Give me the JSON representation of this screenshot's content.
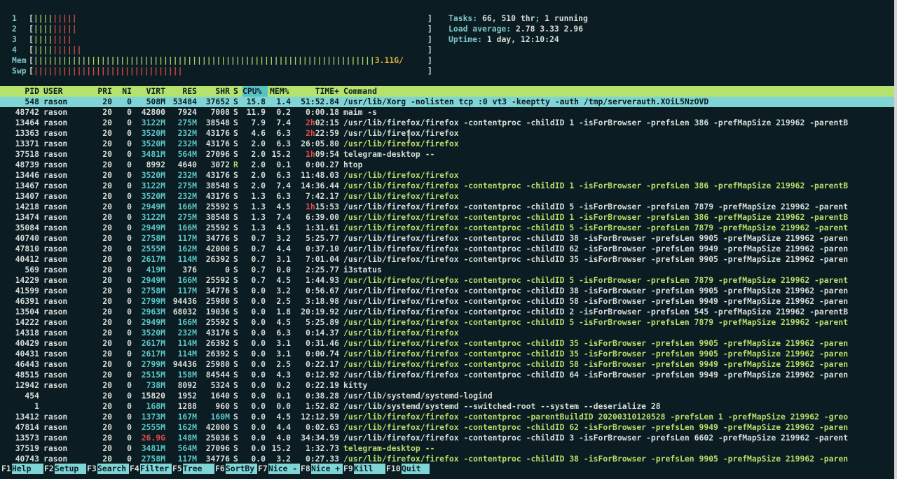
{
  "meters": {
    "cpus": [
      {
        "label": "1",
        "bar": "[",
        "g": "||||",
        "r": "|||||"
      },
      {
        "label": "2",
        "bar": "[",
        "g": "||||",
        "r": "|||||"
      },
      {
        "label": "3",
        "bar": "[",
        "g": "||||",
        "r": "||||"
      },
      {
        "label": "4",
        "bar": "[",
        "g": "||||",
        "r": "||||||"
      }
    ],
    "mem": {
      "label": "Mem",
      "bar": "[",
      "fill": "|||||||||||||||||||||||||||||||||||||||||||||||||||||||||||||||||||||||",
      "value": "3.11G/"
    },
    "swp": {
      "label": "Swp",
      "bar": "[",
      "fill": "|||||||||||||||||||||||||||||||"
    },
    "close": "]"
  },
  "info": {
    "tasks_label": "Tasks: ",
    "tasks_val": "66, 510 thr",
    "tasks_sep": "; ",
    "running_val": "1 running",
    "load_label": "Load average: ",
    "load_val": "2.78 3.33 2.96",
    "uptime_label": "Uptime: ",
    "uptime_val": "1 day, 12:10:24"
  },
  "header": {
    "pid": "PID",
    "user": "USER",
    "pri": "PRI",
    "ni": "NI",
    "virt": "VIRT",
    "res": "RES",
    "shr": "SHR",
    "s": "S",
    "cpu": "CPU%",
    "mem": "MEM%",
    "time": "TIME+",
    "cmd": "Command"
  },
  "processes": [
    {
      "pid": "548",
      "user": "rason",
      "pri": "20",
      "ni": "0",
      "virt": "508M",
      "res": "53484",
      "shr": "37652",
      "s": "S",
      "cpu": "15.8",
      "mem": "1.4",
      "time": "51:52.84",
      "cmd": "/usr/lib/Xorg -nolisten tcp :0 vt3 -keeptty -auth /tmp/serverauth.XOiL5NzOVD"
    },
    {
      "pid": "48742",
      "user": "rason",
      "pri": "20",
      "ni": "0",
      "virt": "42800",
      "res": "7924",
      "shr": "7008",
      "s": "S",
      "cpu": "11.9",
      "mem": "0.2",
      "time": "0:00.18",
      "cmd": "maim -s"
    },
    {
      "pid": "13464",
      "user": "rason",
      "pri": "20",
      "ni": "0",
      "virt": "3122M",
      "res": "275M",
      "shr": "38548",
      "s": "S",
      "cpu": "7.9",
      "mem": "7.4",
      "time": "2h02:15",
      "cmd": "/usr/lib/firefox/firefox -contentproc -childID 1 -isForBrowser -prefsLen 386 -prefMapSize 219962 -parentB"
    },
    {
      "pid": "13363",
      "user": "rason",
      "pri": "20",
      "ni": "0",
      "virt": "3520M",
      "res": "232M",
      "shr": "43176",
      "s": "S",
      "cpu": "4.6",
      "mem": "6.3",
      "time": "2h22:59",
      "cmd": "/usr/lib/firefox/firefox"
    },
    {
      "pid": "13371",
      "user": "rason",
      "pri": "20",
      "ni": "0",
      "virt": "3520M",
      "res": "232M",
      "shr": "43176",
      "s": "S",
      "cpu": "2.0",
      "mem": "6.3",
      "time": "26:05.80",
      "cmd": "/usr/lib/firefox/firefox"
    },
    {
      "pid": "37518",
      "user": "rason",
      "pri": "20",
      "ni": "0",
      "virt": "3481M",
      "res": "564M",
      "shr": "27096",
      "s": "S",
      "cpu": "2.0",
      "mem": "15.2",
      "time": "1h09:54",
      "cmd": "telegram-desktop --"
    },
    {
      "pid": "48739",
      "user": "rason",
      "pri": "20",
      "ni": "0",
      "virt": "8992",
      "res": "4640",
      "shr": "3072",
      "s": "R",
      "cpu": "2.0",
      "mem": "0.1",
      "time": "0:00.27",
      "cmd": "htop"
    },
    {
      "pid": "13446",
      "user": "rason",
      "pri": "20",
      "ni": "0",
      "virt": "3520M",
      "res": "232M",
      "shr": "43176",
      "s": "S",
      "cpu": "2.0",
      "mem": "6.3",
      "time": "11:48.03",
      "cmd": "/usr/lib/firefox/firefox"
    },
    {
      "pid": "13467",
      "user": "rason",
      "pri": "20",
      "ni": "0",
      "virt": "3122M",
      "res": "275M",
      "shr": "38548",
      "s": "S",
      "cpu": "2.0",
      "mem": "7.4",
      "time": "14:36.44",
      "cmd": "/usr/lib/firefox/firefox -contentproc -childID 1 -isForBrowser -prefsLen 386 -prefMapSize 219962 -parentB"
    },
    {
      "pid": "13407",
      "user": "rason",
      "pri": "20",
      "ni": "0",
      "virt": "3520M",
      "res": "232M",
      "shr": "43176",
      "s": "S",
      "cpu": "1.3",
      "mem": "6.3",
      "time": "7:42.17",
      "cmd": "/usr/lib/firefox/firefox"
    },
    {
      "pid": "14218",
      "user": "rason",
      "pri": "20",
      "ni": "0",
      "virt": "2949M",
      "res": "166M",
      "shr": "25592",
      "s": "S",
      "cpu": "1.3",
      "mem": "4.5",
      "time": "1h15:53",
      "cmd": "/usr/lib/firefox/firefox -contentproc -childID 5 -isForBrowser -prefsLen 7879 -prefMapSize 219962 -parent"
    },
    {
      "pid": "13474",
      "user": "rason",
      "pri": "20",
      "ni": "0",
      "virt": "3122M",
      "res": "275M",
      "shr": "38548",
      "s": "S",
      "cpu": "1.3",
      "mem": "7.4",
      "time": "6:39.00",
      "cmd": "/usr/lib/firefox/firefox -contentproc -childID 1 -isForBrowser -prefsLen 386 -prefMapSize 219962 -parentB"
    },
    {
      "pid": "35084",
      "user": "rason",
      "pri": "20",
      "ni": "0",
      "virt": "2949M",
      "res": "166M",
      "shr": "25592",
      "s": "S",
      "cpu": "1.3",
      "mem": "4.5",
      "time": "1:31.61",
      "cmd": "/usr/lib/firefox/firefox -contentproc -childID 5 -isForBrowser -prefsLen 7879 -prefMapSize 219962 -parent"
    },
    {
      "pid": "40740",
      "user": "rason",
      "pri": "20",
      "ni": "0",
      "virt": "2758M",
      "res": "117M",
      "shr": "34776",
      "s": "S",
      "cpu": "0.7",
      "mem": "3.2",
      "time": "5:25.77",
      "cmd": "/usr/lib/firefox/firefox -contentproc -childID 38 -isForBrowser -prefsLen 9905 -prefMapSize 219962 -paren"
    },
    {
      "pid": "47810",
      "user": "rason",
      "pri": "20",
      "ni": "0",
      "virt": "2555M",
      "res": "162M",
      "shr": "42000",
      "s": "S",
      "cpu": "0.7",
      "mem": "4.4",
      "time": "0:37.10",
      "cmd": "/usr/lib/firefox/firefox -contentproc -childID 62 -isForBrowser -prefsLen 9949 -prefMapSize 219962 -paren"
    },
    {
      "pid": "40412",
      "user": "rason",
      "pri": "20",
      "ni": "0",
      "virt": "2617M",
      "res": "114M",
      "shr": "26392",
      "s": "S",
      "cpu": "0.7",
      "mem": "3.1",
      "time": "7:01.04",
      "cmd": "/usr/lib/firefox/firefox -contentproc -childID 35 -isForBrowser -prefsLen 9905 -prefMapSize 219962 -paren"
    },
    {
      "pid": "569",
      "user": "rason",
      "pri": "20",
      "ni": "0",
      "virt": "419M",
      "res": "376",
      "shr": "0",
      "s": "S",
      "cpu": "0.7",
      "mem": "0.0",
      "time": "2:25.77",
      "cmd": "i3status"
    },
    {
      "pid": "14229",
      "user": "rason",
      "pri": "20",
      "ni": "0",
      "virt": "2949M",
      "res": "166M",
      "shr": "25592",
      "s": "S",
      "cpu": "0.7",
      "mem": "4.5",
      "time": "1:44.93",
      "cmd": "/usr/lib/firefox/firefox -contentproc -childID 5 -isForBrowser -prefsLen 7879 -prefMapSize 219962 -parent"
    },
    {
      "pid": "41599",
      "user": "rason",
      "pri": "20",
      "ni": "0",
      "virt": "2758M",
      "res": "117M",
      "shr": "34776",
      "s": "S",
      "cpu": "0.0",
      "mem": "3.2",
      "time": "0:56.67",
      "cmd": "/usr/lib/firefox/firefox -contentproc -childID 38 -isForBrowser -prefsLen 9905 -prefMapSize 219962 -paren"
    },
    {
      "pid": "46391",
      "user": "rason",
      "pri": "20",
      "ni": "0",
      "virt": "2799M",
      "res": "94436",
      "shr": "25980",
      "s": "S",
      "cpu": "0.0",
      "mem": "2.5",
      "time": "3:18.98",
      "cmd": "/usr/lib/firefox/firefox -contentproc -childID 58 -isForBrowser -prefsLen 9949 -prefMapSize 219962 -paren"
    },
    {
      "pid": "13504",
      "user": "rason",
      "pri": "20",
      "ni": "0",
      "virt": "2963M",
      "res": "68032",
      "shr": "19036",
      "s": "S",
      "cpu": "0.0",
      "mem": "1.8",
      "time": "20:19.92",
      "cmd": "/usr/lib/firefox/firefox -contentproc -childID 2 -isForBrowser -prefsLen 545 -prefMapSize 219962 -parentB"
    },
    {
      "pid": "14222",
      "user": "rason",
      "pri": "20",
      "ni": "0",
      "virt": "2949M",
      "res": "166M",
      "shr": "25592",
      "s": "S",
      "cpu": "0.0",
      "mem": "4.5",
      "time": "5:25.89",
      "cmd": "/usr/lib/firefox/firefox -contentproc -childID 5 -isForBrowser -prefsLen 7879 -prefMapSize 219962 -parent"
    },
    {
      "pid": "14318",
      "user": "rason",
      "pri": "20",
      "ni": "0",
      "virt": "3520M",
      "res": "232M",
      "shr": "43176",
      "s": "S",
      "cpu": "0.0",
      "mem": "6.3",
      "time": "0:14.37",
      "cmd": "/usr/lib/firefox/firefox"
    },
    {
      "pid": "40429",
      "user": "rason",
      "pri": "20",
      "ni": "0",
      "virt": "2617M",
      "res": "114M",
      "shr": "26392",
      "s": "S",
      "cpu": "0.0",
      "mem": "3.1",
      "time": "0:31.46",
      "cmd": "/usr/lib/firefox/firefox -contentproc -childID 35 -isForBrowser -prefsLen 9905 -prefMapSize 219962 -paren"
    },
    {
      "pid": "40431",
      "user": "rason",
      "pri": "20",
      "ni": "0",
      "virt": "2617M",
      "res": "114M",
      "shr": "26392",
      "s": "S",
      "cpu": "0.0",
      "mem": "3.1",
      "time": "0:00.74",
      "cmd": "/usr/lib/firefox/firefox -contentproc -childID 35 -isForBrowser -prefsLen 9905 -prefMapSize 219962 -paren"
    },
    {
      "pid": "46443",
      "user": "rason",
      "pri": "20",
      "ni": "0",
      "virt": "2799M",
      "res": "94436",
      "shr": "25980",
      "s": "S",
      "cpu": "0.0",
      "mem": "2.5",
      "time": "0:22.17",
      "cmd": "/usr/lib/firefox/firefox -contentproc -childID 58 -isForBrowser -prefsLen 9949 -prefMapSize 219962 -paren"
    },
    {
      "pid": "48515",
      "user": "rason",
      "pri": "20",
      "ni": "0",
      "virt": "2515M",
      "res": "158M",
      "shr": "84544",
      "s": "S",
      "cpu": "0.0",
      "mem": "4.3",
      "time": "0:12.92",
      "cmd": "/usr/lib/firefox/firefox -contentproc -childID 64 -isForBrowser -prefsLen 9949 -prefMapSize 219962 -paren"
    },
    {
      "pid": "12942",
      "user": "rason",
      "pri": "20",
      "ni": "0",
      "virt": "738M",
      "res": "8092",
      "shr": "5324",
      "s": "S",
      "cpu": "0.0",
      "mem": "0.2",
      "time": "0:22.19",
      "cmd": "kitty"
    },
    {
      "pid": "454",
      "user": "",
      "pri": "20",
      "ni": "0",
      "virt": "15820",
      "res": "1952",
      "shr": "1640",
      "s": "S",
      "cpu": "0.0",
      "mem": "0.1",
      "time": "0:38.28",
      "cmd": "/usr/lib/systemd/systemd-logind"
    },
    {
      "pid": "1",
      "user": "",
      "pri": "20",
      "ni": "0",
      "virt": "168M",
      "res": "1288",
      "shr": "960",
      "s": "S",
      "cpu": "0.0",
      "mem": "0.0",
      "time": "1:52.82",
      "cmd": "/usr/lib/systemd/systemd --switched-root --system --deserialize 28"
    },
    {
      "pid": "13412",
      "user": "rason",
      "pri": "20",
      "ni": "0",
      "virt": "1373M",
      "res": "167M",
      "shr": "160M",
      "s": "S",
      "cpu": "0.0",
      "mem": "4.5",
      "time": "12:12.59",
      "cmd": "/usr/lib/firefox/firefox -contentproc -parentBuildID 20200310120528 -prefsLen 1 -prefMapSize 219962 -greo"
    },
    {
      "pid": "47814",
      "user": "rason",
      "pri": "20",
      "ni": "0",
      "virt": "2555M",
      "res": "162M",
      "shr": "42000",
      "s": "S",
      "cpu": "0.0",
      "mem": "4.4",
      "time": "0:02.63",
      "cmd": "/usr/lib/firefox/firefox -contentproc -childID 62 -isForBrowser -prefsLen 9949 -prefMapSize 219962 -paren"
    },
    {
      "pid": "13573",
      "user": "rason",
      "pri": "20",
      "ni": "0",
      "virt": "26.9G",
      "res": "148M",
      "shr": "25036",
      "s": "S",
      "cpu": "0.0",
      "mem": "4.0",
      "time": "34:34.59",
      "cmd": "/usr/lib/firefox/firefox -contentproc -childID 3 -isForBrowser -prefsLen 6602 -prefMapSize 219962 -parent"
    },
    {
      "pid": "37519",
      "user": "rason",
      "pri": "20",
      "ni": "0",
      "virt": "3481M",
      "res": "564M",
      "shr": "27096",
      "s": "S",
      "cpu": "0.0",
      "mem": "15.2",
      "time": "1:32.73",
      "cmd": "telegram-desktop --"
    },
    {
      "pid": "40743",
      "user": "rason",
      "pri": "20",
      "ni": "0",
      "virt": "2758M",
      "res": "117M",
      "shr": "34776",
      "s": "S",
      "cpu": "0.0",
      "mem": "3.2",
      "time": "0:27.33",
      "cmd": "/usr/lib/firefox/firefox -contentproc -childID 38 -isForBrowser -prefsLen 9905 -prefMapSize 219962 -paren"
    }
  ],
  "green_cmd_rows": [
    4,
    7,
    8,
    9,
    11,
    12,
    17,
    21,
    22,
    23,
    24,
    25,
    30,
    31,
    33,
    34
  ],
  "fkeys": [
    {
      "key": "F1",
      "label": "Help"
    },
    {
      "key": "F2",
      "label": "Setup"
    },
    {
      "key": "F3",
      "label": "Search"
    },
    {
      "key": "F4",
      "label": "Filter"
    },
    {
      "key": "F5",
      "label": "Tree"
    },
    {
      "key": "F6",
      "label": "SortBy"
    },
    {
      "key": "F7",
      "label": "Nice -"
    },
    {
      "key": "F8",
      "label": "Nice +"
    },
    {
      "key": "F9",
      "label": "Kill"
    },
    {
      "key": "F10",
      "label": "Quit"
    }
  ],
  "colors": {
    "bg": "#0b1d22",
    "header": "#b5e26c",
    "selected": "#7fd4d6",
    "accent": "#57c2c4",
    "red": "#e04b4b",
    "green": "#a9d36b"
  }
}
